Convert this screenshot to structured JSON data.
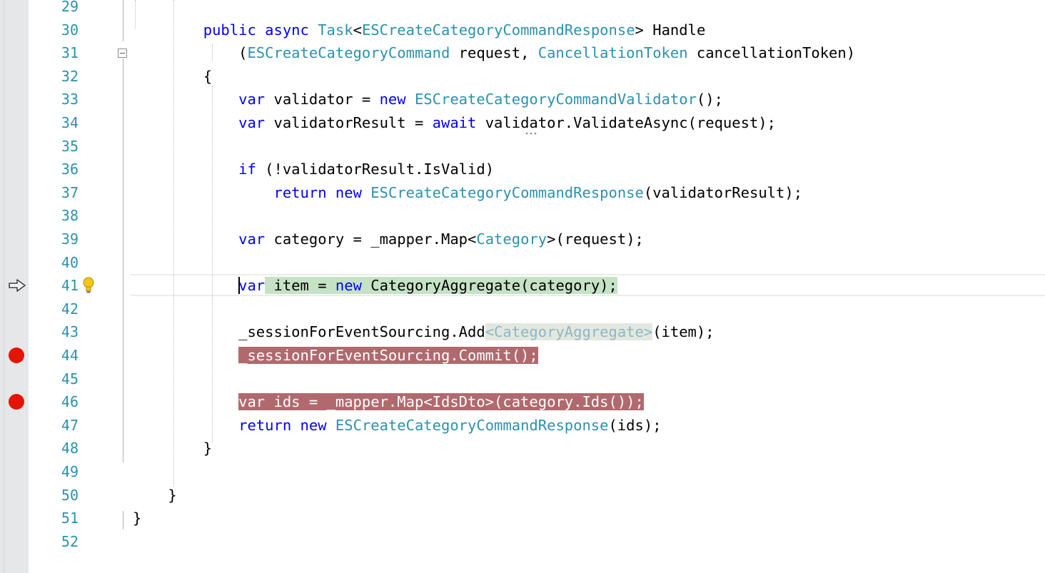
{
  "editor": {
    "lines": [
      {
        "num": "29",
        "tokens": []
      },
      {
        "num": "30",
        "tokens": [
          {
            "t": "        "
          },
          {
            "t": "public",
            "c": "kw"
          },
          {
            "t": " "
          },
          {
            "t": "async",
            "c": "kw"
          },
          {
            "t": " "
          },
          {
            "t": "Task",
            "c": "ty"
          },
          {
            "t": "<"
          },
          {
            "t": "ESCreateCategoryCommandResponse",
            "c": "ty"
          },
          {
            "t": "> Handle"
          }
        ]
      },
      {
        "num": "31",
        "tokens": [
          {
            "t": "            ("
          },
          {
            "t": "ESCreateCategoryCommand",
            "c": "ty"
          },
          {
            "t": " request, "
          },
          {
            "t": "CancellationToken",
            "c": "ty"
          },
          {
            "t": " cancellationToken)"
          }
        ]
      },
      {
        "num": "32",
        "tokens": [
          {
            "t": "        {"
          }
        ]
      },
      {
        "num": "33",
        "tokens": [
          {
            "t": "            "
          },
          {
            "t": "var",
            "c": "kw"
          },
          {
            "t": " validator = "
          },
          {
            "t": "new",
            "c": "kw"
          },
          {
            "t": " "
          },
          {
            "t": "ESCreateCategoryCommandValidator",
            "c": "ty"
          },
          {
            "t": "();"
          }
        ]
      },
      {
        "num": "34",
        "tokens": [
          {
            "t": "            "
          },
          {
            "t": "var",
            "c": "kw"
          },
          {
            "t": " validatorResult = "
          },
          {
            "t": "await",
            "c": "kw"
          },
          {
            "t": " validator.ValidateAsync(request);"
          }
        ]
      },
      {
        "num": "35",
        "tokens": []
      },
      {
        "num": "36",
        "tokens": [
          {
            "t": "            "
          },
          {
            "t": "if",
            "c": "kw"
          },
          {
            "t": " (!validatorResult.IsValid)"
          }
        ]
      },
      {
        "num": "37",
        "tokens": [
          {
            "t": "                "
          },
          {
            "t": "return",
            "c": "kw"
          },
          {
            "t": " "
          },
          {
            "t": "new",
            "c": "kw"
          },
          {
            "t": " "
          },
          {
            "t": "ESCreateCategoryCommandResponse",
            "c": "ty"
          },
          {
            "t": "(validatorResult);"
          }
        ]
      },
      {
        "num": "38",
        "tokens": []
      },
      {
        "num": "39",
        "tokens": [
          {
            "t": "            "
          },
          {
            "t": "var",
            "c": "kw"
          },
          {
            "t": " category = _mapper.Map<"
          },
          {
            "t": "Category",
            "c": "ty"
          },
          {
            "t": ">(request);"
          }
        ]
      },
      {
        "num": "40",
        "tokens": []
      },
      {
        "num": "41",
        "current": true,
        "tokens": [
          {
            "t": "            "
          },
          {
            "caret": true
          },
          {
            "t": "var",
            "c": "kw"
          },
          {
            "t": " item = ",
            "c": "hl-green"
          },
          {
            "t": "new",
            "c": "kw hl-green"
          },
          {
            "t": " CategoryAggregate(category);",
            "c": "hl-green"
          }
        ]
      },
      {
        "num": "42",
        "tokens": []
      },
      {
        "num": "43",
        "tokens": [
          {
            "t": "            _sessionForEventSourcing.Add"
          },
          {
            "t": "<CategoryAggregate>",
            "c": "hl-ghost"
          },
          {
            "t": "(item);"
          }
        ]
      },
      {
        "num": "44",
        "breakpoint": true,
        "tokens": [
          {
            "t": "            "
          },
          {
            "t": "_sessionForEventSourcing.Commit();",
            "c": "bp-line"
          }
        ]
      },
      {
        "num": "45",
        "tokens": []
      },
      {
        "num": "46",
        "breakpoint": true,
        "tokens": [
          {
            "t": "            "
          },
          {
            "t": "var ids = _mapper.Map<IdsDto>(category.Ids());",
            "c": "bp-line"
          }
        ]
      },
      {
        "num": "47",
        "tokens": [
          {
            "t": "            "
          },
          {
            "t": "return",
            "c": "kw"
          },
          {
            "t": " "
          },
          {
            "t": "new",
            "c": "kw"
          },
          {
            "t": " "
          },
          {
            "t": "ESCreateCategoryCommandResponse",
            "c": "ty"
          },
          {
            "t": "(ids);"
          }
        ]
      },
      {
        "num": "48",
        "tokens": [
          {
            "t": "        }"
          }
        ]
      },
      {
        "num": "49",
        "tokens": []
      },
      {
        "num": "50",
        "tokens": [
          {
            "t": "    }"
          }
        ]
      },
      {
        "num": "51",
        "tokens": [
          {
            "t": "}"
          }
        ]
      },
      {
        "num": "52",
        "tokens": []
      }
    ]
  },
  "icons": {
    "breakpoint": "breakpoint-icon",
    "next_statement": "next-statement-arrow-icon",
    "light_bulb": "light-bulb-icon",
    "collapse": "collapse-icon"
  },
  "colors": {
    "line_number": "#2b91af",
    "keyword": "#0000ff",
    "type": "#2b91af",
    "breakpoint": "#e51400",
    "breakpoint_line": "#b06a6e",
    "current_statement": "#c5e2c5"
  }
}
